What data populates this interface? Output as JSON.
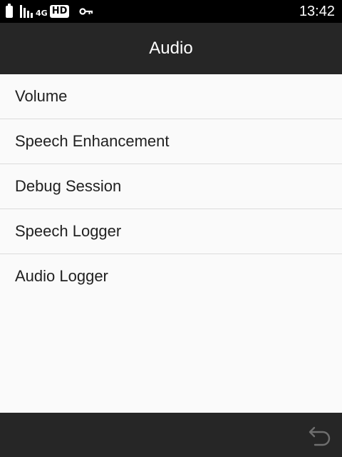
{
  "status_bar": {
    "network_type": "4G",
    "hd_badge": "HD",
    "time": "13:42",
    "icons": [
      "battery-icon",
      "signal-icon",
      "hd-icon",
      "vpn-key-icon"
    ]
  },
  "header": {
    "title": "Audio"
  },
  "menu": {
    "items": [
      {
        "label": "Volume"
      },
      {
        "label": "Speech Enhancement"
      },
      {
        "label": "Debug Session"
      },
      {
        "label": "Speech Logger"
      },
      {
        "label": "Audio Logger"
      }
    ]
  },
  "nav_bar": {
    "icons": [
      "back-icon"
    ]
  },
  "colors": {
    "status_bar_bg": "#000000",
    "app_bar_bg": "#262626",
    "list_bg": "#fafafa",
    "list_text": "#212121",
    "divider": "#dcdcdc",
    "nav_icon": "#6f6f6f"
  }
}
